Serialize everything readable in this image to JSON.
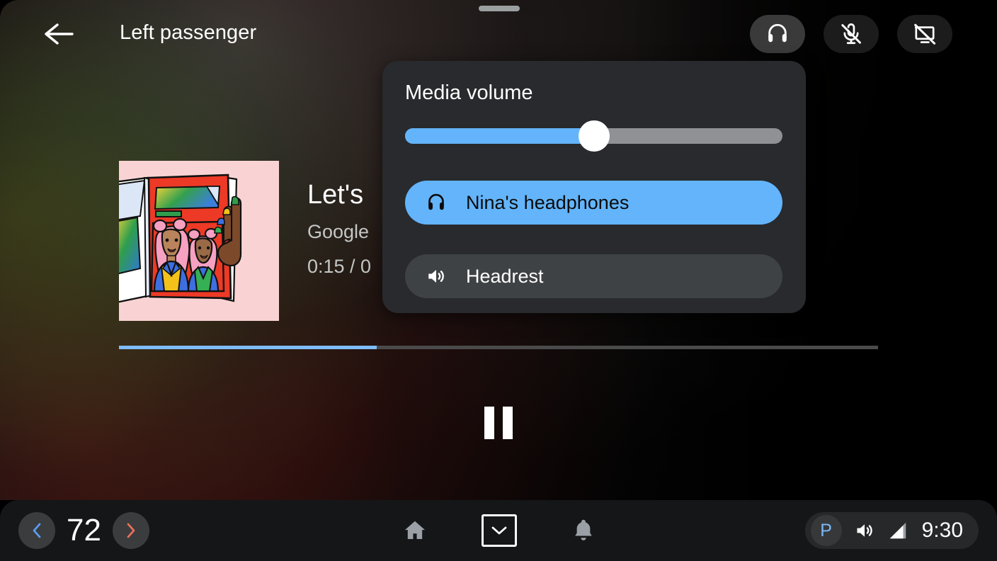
{
  "header": {
    "back_icon": "arrow-left-icon",
    "title": "Left passenger",
    "drag_handle": "drag-handle",
    "actions": [
      {
        "name": "headphones",
        "icon": "headphones-icon",
        "active": true
      },
      {
        "name": "mic-off",
        "icon": "mic-off-icon",
        "active": false
      },
      {
        "name": "screen-off",
        "icon": "screen-off-icon",
        "active": false
      }
    ]
  },
  "media": {
    "album_art_alt": "album-art-illustration",
    "title": "Let's",
    "artist": "Google",
    "time": "0:15 / 0",
    "progress_percent": 34,
    "playback_state": "playing",
    "playback_icon": "pause-icon"
  },
  "volume_panel": {
    "title": "Media volume",
    "slider": {
      "name": "media-volume-slider",
      "value_percent": 50
    },
    "devices": [
      {
        "label": "Nina's headphones",
        "icon": "headphones-icon",
        "selected": true
      },
      {
        "label": "Headrest",
        "icon": "speaker-icon",
        "selected": false
      }
    ]
  },
  "system_bar": {
    "temperature": {
      "decrease_icon": "chevron-left-icon",
      "value": "72",
      "increase_icon": "chevron-right-icon"
    },
    "nav": [
      {
        "name": "home",
        "icon": "home-icon"
      },
      {
        "name": "apps",
        "icon": "chevron-down-icon"
      },
      {
        "name": "notifications",
        "icon": "bell-icon"
      }
    ],
    "status": {
      "gear": "P",
      "volume_icon": "volume-up-icon",
      "signal_icon": "signal-bars-icon",
      "clock": "9:30"
    }
  },
  "colors": {
    "accent_blue": "#63b4fb",
    "progress_blue": "#7ebcfb",
    "panel_bg": "#282a2d",
    "chip_inactive": "#3f4245",
    "system_bar_bg": "#141618",
    "temp_down_blue": "#5b9df0",
    "temp_up_red": "#e8705a",
    "park_blue": "#7cb8f7"
  }
}
